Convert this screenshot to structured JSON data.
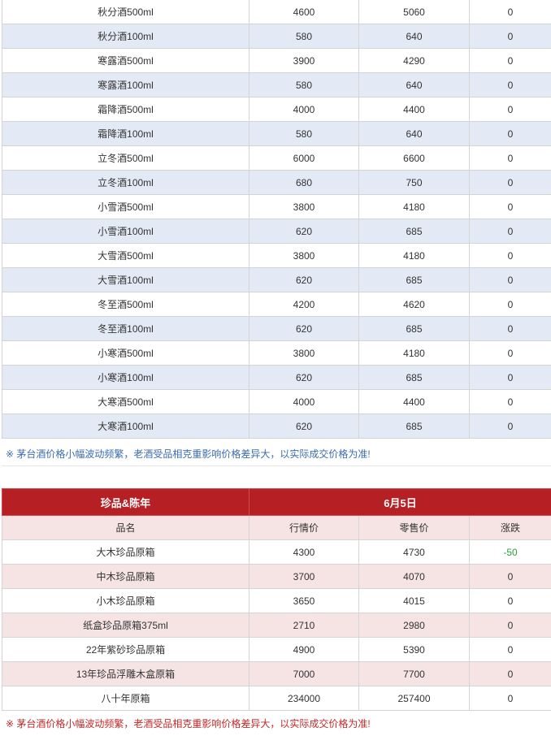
{
  "top_table": {
    "rows": [
      {
        "name": "秋分酒500ml",
        "market": "4600",
        "retail": "5060",
        "change": "0"
      },
      {
        "name": "秋分酒100ml",
        "market": "580",
        "retail": "640",
        "change": "0"
      },
      {
        "name": "寒露酒500ml",
        "market": "3900",
        "retail": "4290",
        "change": "0"
      },
      {
        "name": "寒露酒100ml",
        "market": "580",
        "retail": "640",
        "change": "0"
      },
      {
        "name": "霜降酒500ml",
        "market": "4000",
        "retail": "4400",
        "change": "0"
      },
      {
        "name": "霜降酒100ml",
        "market": "580",
        "retail": "640",
        "change": "0"
      },
      {
        "name": "立冬酒500ml",
        "market": "6000",
        "retail": "6600",
        "change": "0"
      },
      {
        "name": "立冬酒100ml",
        "market": "680",
        "retail": "750",
        "change": "0"
      },
      {
        "name": "小雪酒500ml",
        "market": "3800",
        "retail": "4180",
        "change": "0"
      },
      {
        "name": "小雪酒100ml",
        "market": "620",
        "retail": "685",
        "change": "0"
      },
      {
        "name": "大雪酒500ml",
        "market": "3800",
        "retail": "4180",
        "change": "0"
      },
      {
        "name": "大雪酒100ml",
        "market": "620",
        "retail": "685",
        "change": "0"
      },
      {
        "name": "冬至酒500ml",
        "market": "4200",
        "retail": "4620",
        "change": "0"
      },
      {
        "name": "冬至酒100ml",
        "market": "620",
        "retail": "685",
        "change": "0"
      },
      {
        "name": "小寒酒500ml",
        "market": "3800",
        "retail": "4180",
        "change": "0"
      },
      {
        "name": "小寒酒100ml",
        "market": "620",
        "retail": "685",
        "change": "0"
      },
      {
        "name": "大寒酒500ml",
        "market": "4000",
        "retail": "4400",
        "change": "0"
      },
      {
        "name": "大寒酒100ml",
        "market": "620",
        "retail": "685",
        "change": "0"
      }
    ],
    "note": "※ 茅台酒价格小幅波动频繁，老酒受品相克重影响价格差异大，以实际成交价格为准!"
  },
  "bottom_table": {
    "section_title": "珍品&陈年",
    "date": "6月5日",
    "headers": {
      "name": "品名",
      "market": "行情价",
      "retail": "零售价",
      "change": "涨跌"
    },
    "rows": [
      {
        "name": "大木珍品原箱",
        "market": "4300",
        "retail": "4730",
        "change": "-50"
      },
      {
        "name": "中木珍品原箱",
        "market": "3700",
        "retail": "4070",
        "change": "0"
      },
      {
        "name": "小木珍品原箱",
        "market": "3650",
        "retail": "4015",
        "change": "0"
      },
      {
        "name": "纸盒珍品原箱375ml",
        "market": "2710",
        "retail": "2980",
        "change": "0"
      },
      {
        "name": "22年紫砂珍品原箱",
        "market": "4900",
        "retail": "5390",
        "change": "0"
      },
      {
        "name": "13年珍品浮雕木盒原箱",
        "market": "7000",
        "retail": "7700",
        "change": "0"
      },
      {
        "name": "八十年原箱",
        "market": "234000",
        "retail": "257400",
        "change": "0"
      }
    ],
    "note": "※ 茅台酒价格小幅波动频繁，老酒受品相克重影响价格差异大，以实际成交价格为准!",
    "colors": {
      "header_bg": "#b61f24",
      "alt_row_bg": "#f6e4e4",
      "down": "#2e9e3a"
    }
  }
}
